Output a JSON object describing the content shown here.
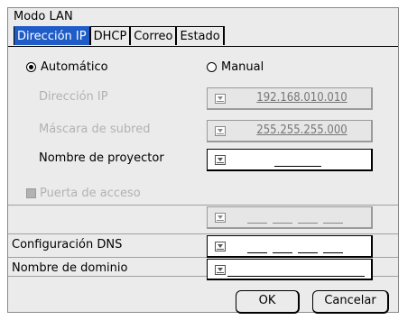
{
  "window": {
    "title": "Modo LAN"
  },
  "tabs": [
    {
      "label": "Dirección IP",
      "active": true
    },
    {
      "label": "DHCP",
      "active": false
    },
    {
      "label": "Correo",
      "active": false
    },
    {
      "label": "Estado",
      "active": false
    }
  ],
  "mode": {
    "auto_label": "Automático",
    "manual_label": "Manual",
    "selected": "Automático"
  },
  "ip": {
    "label": "Dirección IP",
    "value": "192.168.010.010",
    "enabled": false
  },
  "subnet": {
    "label": "Máscara de subred",
    "value": "255.255.255.000",
    "enabled": false
  },
  "projector": {
    "label": "Nombre de proyector",
    "value": ""
  },
  "gateway": {
    "label": "Puerta de acceso",
    "checked": false,
    "enabled": false
  },
  "dns": {
    "label": "Configuración DNS"
  },
  "domain": {
    "label": "Nombre de dominio",
    "value": ""
  },
  "buttons": {
    "ok": "OK",
    "cancel": "Cancelar"
  },
  "colors": {
    "tab_active": "#1f5cc8",
    "background": "#ebebeb",
    "disabled_text": "#b2b2b2"
  }
}
